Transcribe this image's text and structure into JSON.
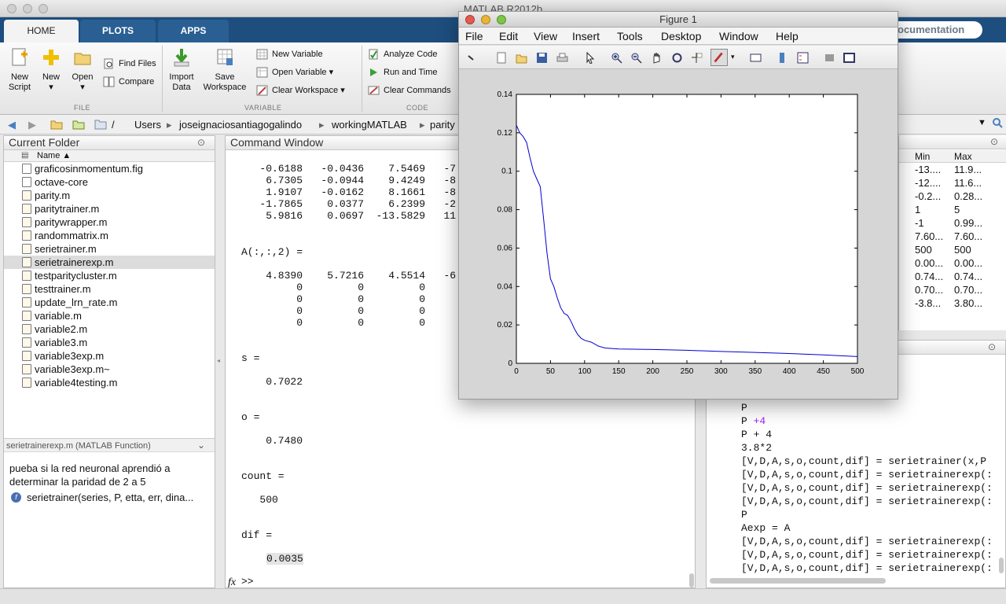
{
  "app": {
    "title": "MATLAB R2012b",
    "doc_search": "ocumentation"
  },
  "tabs": [
    "HOME",
    "PLOTS",
    "APPS"
  ],
  "ribbon": {
    "file": {
      "group": "FILE",
      "new_script": "New\nScript",
      "new": "New",
      "open": "Open",
      "find_files": "Find Files",
      "compare": "Compare"
    },
    "variable": {
      "group": "VARIABLE",
      "import_data": "Import\nData",
      "save_workspace": "Save\nWorkspace",
      "new_variable": "New Variable",
      "open_variable": "Open Variable",
      "clear_workspace": "Clear Workspace"
    },
    "code": {
      "group": "CODE",
      "analyze_code": "Analyze Code",
      "run_and_time": "Run and Time",
      "clear_commands": "Clear Commands"
    }
  },
  "address": {
    "root": "/",
    "parts": [
      "Users",
      "joseignaciosantiagogalindo",
      "workingMATLAB",
      "parity"
    ]
  },
  "current_folder": {
    "title": "Current Folder",
    "column": "Name ▲",
    "files": [
      "graficosinmomentum.fig",
      "octave-core",
      "parity.m",
      "paritytrainer.m",
      "paritywrapper.m",
      "randommatrix.m",
      "serietrainer.m",
      "serietrainerexp.m",
      "testparitycluster.m",
      "testtrainer.m",
      "update_lrn_rate.m",
      "variable.m",
      "variable2.m",
      "variable3.m",
      "variable3exp.m",
      "variable3exp.m~",
      "variable4testing.m"
    ],
    "selected": "serietrainerexp.m",
    "details_title": "serietrainerexp.m (MATLAB Function)",
    "details_desc": "pueba si la red neuronal aprendió a\ndeterminar la paridad de 2 a 5",
    "details_sig": "serietrainer(series, P, etta, err, dina..."
  },
  "command_window": {
    "title": "Command Window",
    "matrix1": [
      "   -0.6188   -0.0436    7.5469   -7",
      "    6.7305   -0.0944    9.4249   -8",
      "    1.9107   -0.0162    8.1661   -8",
      "   -1.7865    0.0377    6.2399   -2",
      "    5.9816    0.0697  -13.5829   11"
    ],
    "a_label": "A(:,:,2) =",
    "matrix2": [
      "    4.8390    5.7216    4.5514   -6",
      "         0         0         0",
      "         0         0         0",
      "         0         0         0",
      "         0         0         0"
    ],
    "s_label": "s =",
    "s_value": "    0.7022",
    "o_label": "o =",
    "o_value": "    0.7480",
    "count_label": "count =",
    "count_value": "   500",
    "dif_label": "dif =",
    "dif_value": "0.0035",
    "prompt": ">>",
    "fx": "fx"
  },
  "workspace": {
    "col_min": "Min",
    "col_max": "Max",
    "rows": [
      [
        "-13....",
        "11.9..."
      ],
      [
        "-12....",
        "11.6..."
      ],
      [
        "-0.2...",
        "0.28..."
      ],
      [
        "1",
        "5"
      ],
      [
        "-1",
        "0.99..."
      ],
      [
        "7.60...",
        "7.60..."
      ],
      [
        "500",
        "500"
      ],
      [
        "0.00...",
        "0.00..."
      ],
      [
        "0.74...",
        "0.74..."
      ],
      [
        "0.70...",
        "0.70..."
      ],
      [
        "-3.8...",
        "3.80..."
      ]
    ]
  },
  "history": {
    "lines": [
      "P",
      "P +4",
      "P + 4",
      "3.8*2",
      "[V,D,A,s,o,count,dif] = serietrainer(x,P",
      "[V,D,A,s,o,count,dif] = serietrainerexp(:",
      "[V,D,A,s,o,count,dif] = serietrainerexp(:",
      "[V,D,A,s,o,count,dif] = serietrainerexp(:",
      "P",
      "Aexp = A",
      "[V,D,A,s,o,count,dif] = serietrainerexp(:",
      "[V,D,A,s,o,count,dif] = serietrainerexp(:",
      "[V,D,A,s,o,count,dif] = serietrainerexp(:"
    ]
  },
  "figure": {
    "title": "Figure 1",
    "menu": [
      "File",
      "Edit",
      "View",
      "Insert",
      "Tools",
      "Desktop",
      "Window",
      "Help"
    ]
  },
  "chart_data": {
    "type": "line",
    "title": "",
    "xlabel": "",
    "ylabel": "",
    "xlim": [
      0,
      500
    ],
    "ylim": [
      0,
      0.14
    ],
    "xticks": [
      0,
      50,
      100,
      150,
      200,
      250,
      300,
      350,
      400,
      450,
      500
    ],
    "yticks": [
      0,
      0.02,
      0.04,
      0.06,
      0.08,
      0.1,
      0.12,
      0.14
    ],
    "line_color": "#0000cc",
    "x": [
      0,
      5,
      10,
      15,
      20,
      25,
      30,
      35,
      40,
      45,
      50,
      55,
      60,
      65,
      70,
      75,
      80,
      85,
      90,
      95,
      100,
      110,
      120,
      130,
      150,
      200,
      250,
      300,
      350,
      400,
      450,
      500
    ],
    "y": [
      0.124,
      0.12,
      0.118,
      0.115,
      0.107,
      0.1,
      0.096,
      0.092,
      0.075,
      0.057,
      0.044,
      0.04,
      0.034,
      0.029,
      0.026,
      0.025,
      0.022,
      0.018,
      0.015,
      0.013,
      0.012,
      0.011,
      0.009,
      0.008,
      0.0075,
      0.0072,
      0.0068,
      0.0062,
      0.0057,
      0.0051,
      0.0044,
      0.0035
    ]
  }
}
